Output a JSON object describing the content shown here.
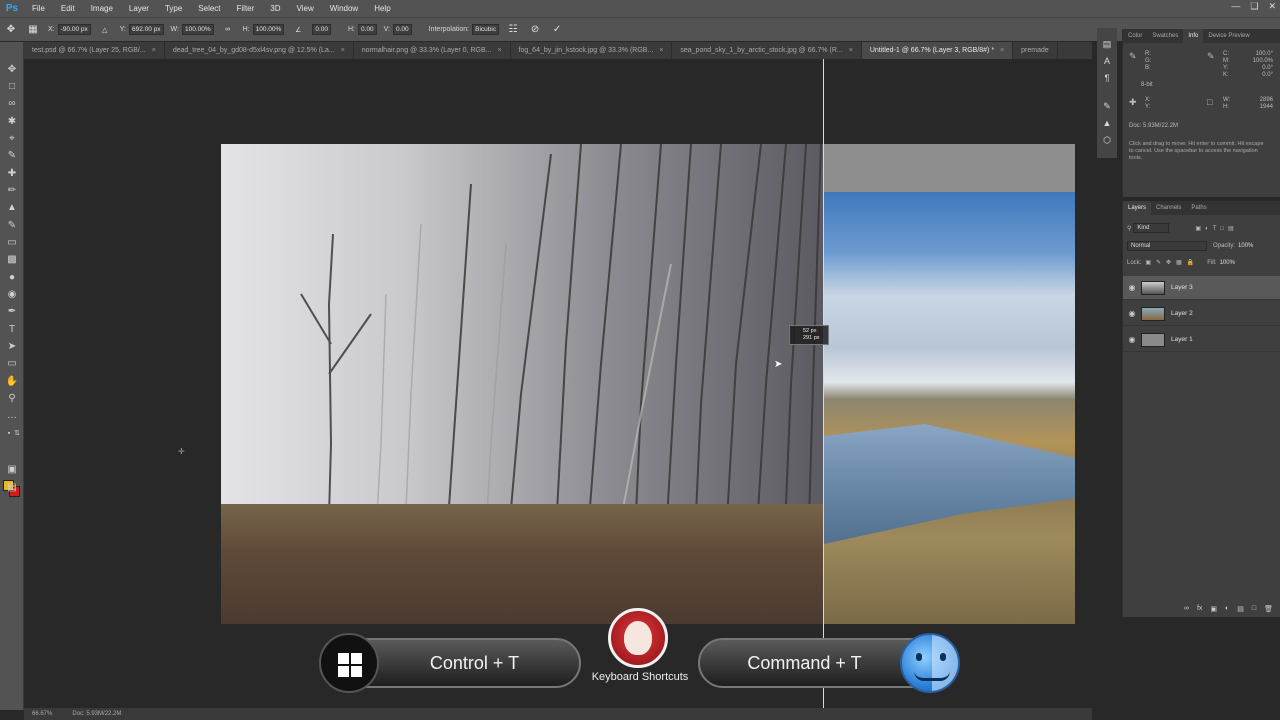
{
  "app": {
    "logo": "Ps"
  },
  "menu": [
    "File",
    "Edit",
    "Image",
    "Layer",
    "Type",
    "Select",
    "Filter",
    "3D",
    "View",
    "Window",
    "Help"
  ],
  "options": {
    "x_label": "X:",
    "x_value": "-90.00 px",
    "y_label": "Y:",
    "y_value": "692.00 px",
    "w_label": "W:",
    "w_value": "100.00%",
    "h_label": "H:",
    "h_value": "100.00%",
    "angle_value": "0.00",
    "hskew_label": "H:",
    "hskew_value": "0.00",
    "vskew_label": "V:",
    "vskew_value": "0.00",
    "interp_label": "Interpolation:",
    "interp_value": "Bicubic"
  },
  "tabs": [
    "test.psd @ 66.7% (Layer 25, RGB/...",
    "dead_tree_04_by_gd08-d5xl4sv.png @ 12.5% (La...",
    "normalhair.png @ 33.3% (Layer 0, RGB...",
    "fog_64_by_jin_kstock.jpg @ 33.3% (RGB...",
    "sea_pond_sky_1_by_arctic_stock.jpg @ 66.7% (R...",
    "Untitled-1 @ 66.7% (Layer 3, RGB/8#) *",
    "premade"
  ],
  "active_tab": 5,
  "measure": {
    "line1": "52 px",
    "line2": "291 px"
  },
  "overlay": {
    "left_shortcut": "Control + T",
    "right_shortcut": "Command + T",
    "caption": "Keyboard Shortcuts"
  },
  "status": {
    "zoom": "66.67%",
    "doc": "Doc: 5.93M/22.2M"
  },
  "info_panel": {
    "tabs": [
      "Color",
      "Swatches",
      "Info",
      "Device Preview"
    ],
    "active_tab": 2,
    "rgb_labels": "R:\nG:\nB:",
    "cmyk_labels": "C:\nM:\nY:\nK:",
    "cmyk_values": "100.0°\n100.0%\n0.0°\n0.0°",
    "bit": "8-bit",
    "xy_labels": "X:\nY:",
    "wh_labels": "W:\nH:",
    "wh_values": "2896\n1944",
    "doc": "Doc: 5.93M/22.2M",
    "help": "Click and drag to move. Hit enter to commit. Hit escape to cancel. Use the spacebar to access the navigation tools."
  },
  "layers_panel": {
    "tabs": [
      "Layers",
      "Channels",
      "Paths"
    ],
    "active_tab": 0,
    "kind_label": "Kind",
    "blend_mode": "Normal",
    "opacity_label": "Opacity:",
    "opacity_value": "100%",
    "lock_label": "Lock:",
    "fill_label": "Fill:",
    "fill_value": "100%",
    "layers": [
      {
        "name": "Layer 3",
        "selected": true
      },
      {
        "name": "Layer 2",
        "selected": false
      },
      {
        "name": "Layer 1",
        "selected": false
      }
    ]
  }
}
